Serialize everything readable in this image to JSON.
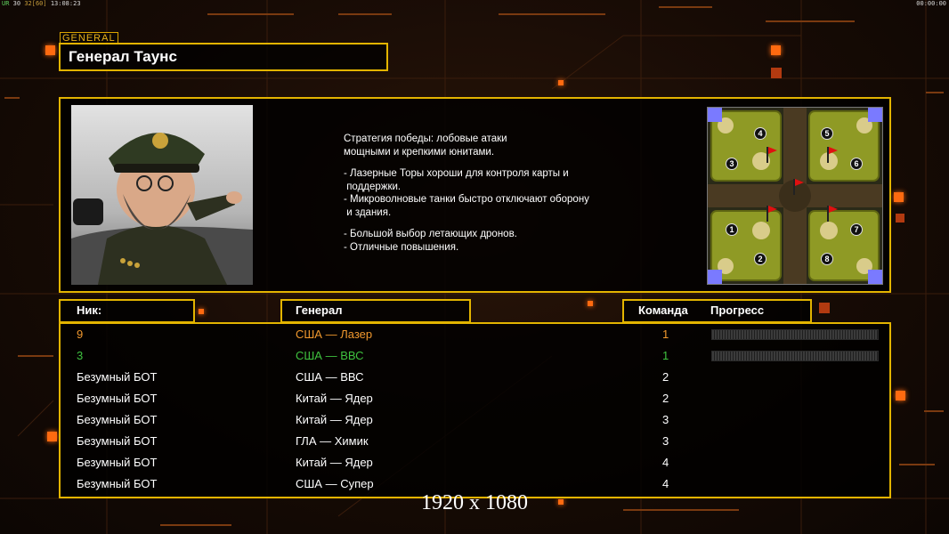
{
  "status_bar": {
    "ur": "UR",
    "fps": "30",
    "fps_limit": "32[60]",
    "clock": "13:08:23",
    "timer": "00:00:00"
  },
  "general": {
    "tag": "GENERAL",
    "name": "Генерал Таунс",
    "portrait_icon": "general-townes-portrait",
    "strategy_lines": [
      "Стратегия победы: лобовые атаки",
      "мощными и крепкими юнитами.",
      "",
      "- Лазерные Торы хороши для контроля карты и",
      " поддержки.",
      "- Микроволновые танки быстро отключают оборону",
      " и здания.",
      "",
      "- Большой выбор летающих дронов.",
      "- Отличные повышения."
    ]
  },
  "minimap": {
    "icon": "minimap-8-player",
    "slots": [
      "1",
      "2",
      "3",
      "4",
      "5",
      "6",
      "7",
      "8"
    ]
  },
  "columns": {
    "nick": "Ник:",
    "general": "Генерал",
    "team": "Команда",
    "progress": "Прогресс"
  },
  "players": [
    {
      "nick": "9",
      "general": "США — Лазер",
      "team": "1",
      "color": "#f0982e",
      "progress": 0
    },
    {
      "nick": "3",
      "general": "США — ВВС",
      "team": "1",
      "color": "#3fc23f",
      "progress": 0
    },
    {
      "nick": "Безумный БОТ",
      "general": "США — ВВС",
      "team": "2",
      "color": "#ffffff"
    },
    {
      "nick": "Безумный БОТ",
      "general": "Китай — Ядер",
      "team": "2",
      "color": "#ffffff"
    },
    {
      "nick": "Безумный БОТ",
      "general": "Китай — Ядер",
      "team": "3",
      "color": "#ffffff"
    },
    {
      "nick": "Безумный БОТ",
      "general": "ГЛА — Химик",
      "team": "3",
      "color": "#ffffff"
    },
    {
      "nick": "Безумный БОТ",
      "general": "Китай — Ядер",
      "team": "4",
      "color": "#ffffff"
    },
    {
      "nick": "Безумный БОТ",
      "general": "США — Супер",
      "team": "4",
      "color": "#ffffff"
    }
  ],
  "resolution": "1920 x 1080",
  "colors": {
    "frame": "#e3b400",
    "accent": "#ff6a10"
  }
}
